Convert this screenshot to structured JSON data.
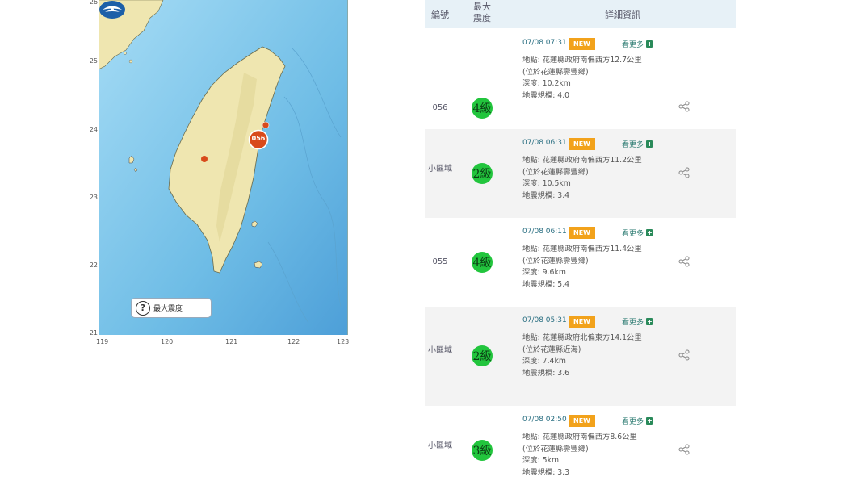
{
  "map": {
    "y_ticks": [
      "26",
      "25",
      "24",
      "23",
      "22",
      "21"
    ],
    "x_ticks": [
      "119",
      "120",
      "121",
      "122",
      "123"
    ],
    "marker_label": "056",
    "legend_label": "最大震度",
    "colors": {
      "sea": "#7fc6ea",
      "land": "#efe6b0",
      "marker": "#d84a1b"
    }
  },
  "table": {
    "headers": {
      "id": "編號",
      "intensity": "最大震度",
      "details": "詳細資訊"
    },
    "rows": [
      {
        "id": "056",
        "intensity": "4級",
        "time": "07/08 07:31",
        "badge": "NEW",
        "more": "看更多",
        "location": "地點: 花蓮縣政府南偏西方12.7公里",
        "sub": "(位於花蓮縣壽豐鄉)",
        "depth": "深度: 10.2km",
        "magnitude": "地震規模: 4.0"
      },
      {
        "id": "小區域",
        "intensity": "2級",
        "time": "07/08 06:31",
        "badge": "NEW",
        "more": "看更多",
        "location": "地點: 花蓮縣政府南偏西方11.2公里",
        "sub": "(位於花蓮縣壽豐鄉)",
        "depth": "深度: 10.5km",
        "magnitude": "地震規模: 3.4"
      },
      {
        "id": "055",
        "intensity": "4級",
        "time": "07/08 06:11",
        "badge": "NEW",
        "more": "看更多",
        "location": "地點: 花蓮縣政府南偏西方11.4公里",
        "sub": "(位於花蓮縣壽豐鄉)",
        "depth": "深度: 9.6km",
        "magnitude": "地震規模: 5.4"
      },
      {
        "id": "小區域",
        "intensity": "2級",
        "time": "07/08 05:31",
        "badge": "NEW",
        "more": "看更多",
        "location": "地點: 花蓮縣政府北偏東方14.1公里",
        "sub": "(位於花蓮縣近海)",
        "depth": "深度: 7.4km",
        "magnitude": "地震規模: 3.6"
      },
      {
        "id": "小區域",
        "intensity": "3級",
        "time": "07/08 02:50",
        "badge": "NEW",
        "more": "看更多",
        "location": "地點: 花蓮縣政府南偏西方8.6公里",
        "sub": "(位於花蓮縣壽豐鄉)",
        "depth": "深度: 5km",
        "magnitude": "地震規模: 3.3"
      }
    ]
  }
}
